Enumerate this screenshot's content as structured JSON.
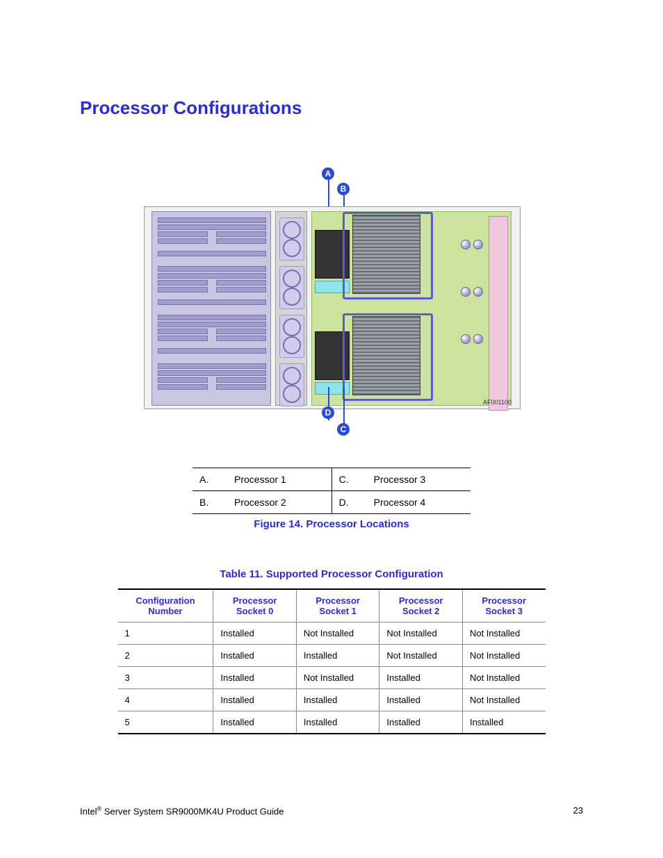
{
  "heading": "Processor Configurations",
  "figure": {
    "caption": "Figure 14. Processor Locations",
    "callouts": {
      "A": "A",
      "B": "B",
      "C": "C",
      "D": "D"
    },
    "diagram_id": "AF001100",
    "legend": [
      {
        "letter": "A.",
        "label": "Processor 1",
        "letter2": "C.",
        "label2": "Processor 3"
      },
      {
        "letter": "B.",
        "label": "Processor 2",
        "letter2": "D.",
        "label2": "Processor 4"
      }
    ]
  },
  "table": {
    "caption": "Table 11. Supported Processor Configuration",
    "headers": [
      "Configuration Number",
      "Processor Socket 0",
      "Processor Socket 1",
      "Processor Socket 2",
      "Processor Socket 3"
    ],
    "rows": [
      [
        "1",
        "Installed",
        "Not Installed",
        "Not Installed",
        "Not Installed"
      ],
      [
        "2",
        "Installed",
        "Installed",
        "Not Installed",
        "Not Installed"
      ],
      [
        "3",
        "Installed",
        "Not Installed",
        "Installed",
        "Not Installed"
      ],
      [
        "4",
        "Installed",
        "Installed",
        "Installed",
        "Not Installed"
      ],
      [
        "5",
        "Installed",
        "Installed",
        "Installed",
        "Installed"
      ]
    ]
  },
  "footer": {
    "left_pre": "Intel",
    "left_post": " Server System SR9000MK4U Product Guide",
    "reg": "®",
    "page": "23"
  }
}
